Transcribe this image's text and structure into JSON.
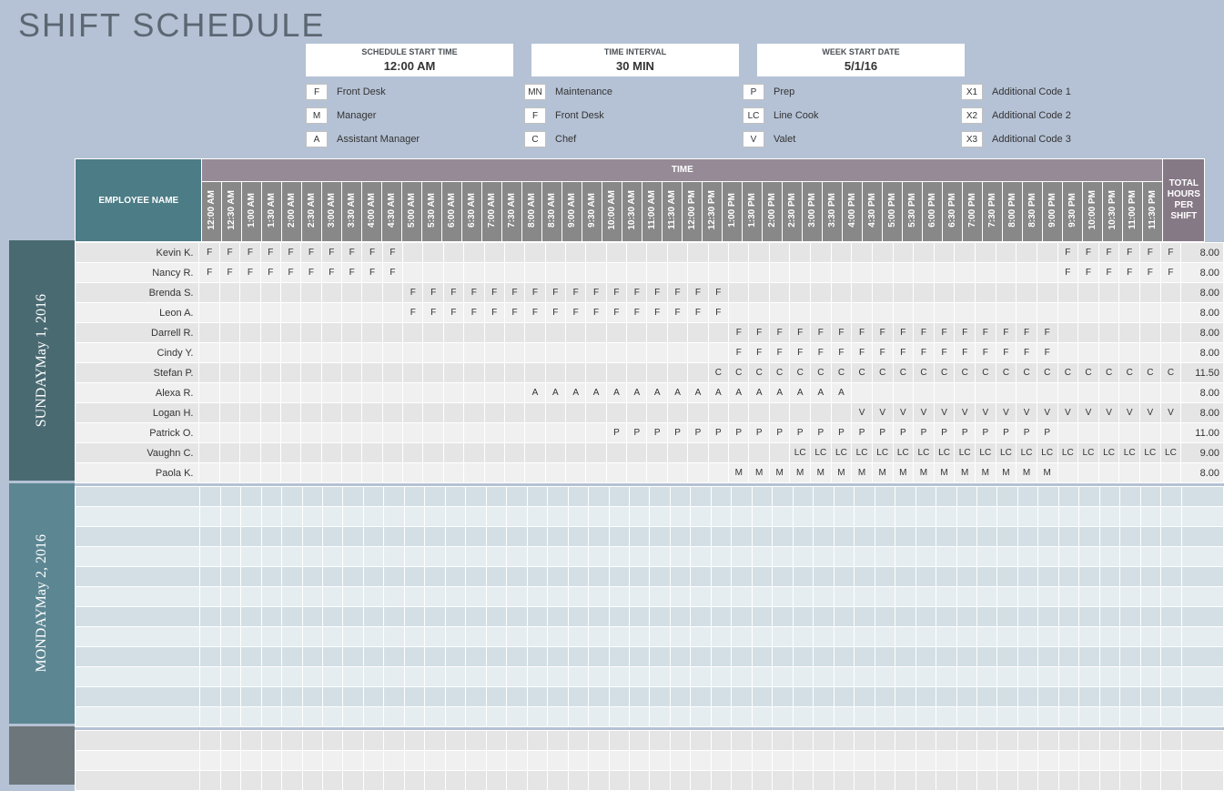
{
  "title": "SHIFT SCHEDULE",
  "hdr": [
    {
      "t": "SCHEDULE START TIME",
      "v": "12:00 AM"
    },
    {
      "t": "TIME INTERVAL",
      "v": "30 MIN"
    },
    {
      "t": "WEEK START DATE",
      "v": "5/1/16"
    }
  ],
  "legend": [
    {
      "c": "F",
      "l": "Front Desk"
    },
    {
      "c": "MN",
      "l": "Maintenance"
    },
    {
      "c": "P",
      "l": "Prep"
    },
    {
      "c": "X1",
      "l": "Additional Code 1"
    },
    {
      "c": "M",
      "l": "Manager"
    },
    {
      "c": "F",
      "l": "Front Desk"
    },
    {
      "c": "LC",
      "l": "Line Cook"
    },
    {
      "c": "X2",
      "l": "Additional Code 2"
    },
    {
      "c": "A",
      "l": "Assistant Manager"
    },
    {
      "c": "C",
      "l": "Chef"
    },
    {
      "c": "V",
      "l": "Valet"
    },
    {
      "c": "X3",
      "l": "Additional Code 3"
    }
  ],
  "cols": {
    "emp": "EMPLOYEE NAME",
    "time": "TIME",
    "total": "TOTAL HOURS PER SHIFT"
  },
  "times": [
    "12:00 AM",
    "12:30 AM",
    "1:00 AM",
    "1:30 AM",
    "2:00 AM",
    "2:30 AM",
    "3:00 AM",
    "3:30 AM",
    "4:00 AM",
    "4:30 AM",
    "5:00 AM",
    "5:30 AM",
    "6:00 AM",
    "6:30 AM",
    "7:00 AM",
    "7:30 AM",
    "8:00 AM",
    "8:30 AM",
    "9:00 AM",
    "9:30 AM",
    "10:00 AM",
    "10:30 AM",
    "11:00 AM",
    "11:30 AM",
    "12:00 PM",
    "12:30 PM",
    "1:00 PM",
    "1:30 PM",
    "2:00 PM",
    "2:30 PM",
    "3:00 PM",
    "3:30 PM",
    "4:00 PM",
    "4:30 PM",
    "5:00 PM",
    "5:30 PM",
    "6:00 PM",
    "6:30 PM",
    "7:00 PM",
    "7:30 PM",
    "8:00 PM",
    "8:30 PM",
    "9:00 PM",
    "9:30 PM",
    "10:00 PM",
    "10:30 PM",
    "11:00 PM",
    "11:30 PM"
  ],
  "days": [
    {
      "name": "SUNDAY",
      "date": "May 1, 2016",
      "rows": [
        {
          "n": "Kevin K.",
          "t": "8.00",
          "s": [
            [
              0,
              9,
              "F"
            ],
            [
              42,
              47,
              "F"
            ]
          ]
        },
        {
          "n": "Nancy R.",
          "t": "8.00",
          "s": [
            [
              0,
              9,
              "F"
            ],
            [
              42,
              47,
              "F"
            ]
          ]
        },
        {
          "n": "Brenda S.",
          "t": "8.00",
          "s": [
            [
              10,
              25,
              "F"
            ]
          ]
        },
        {
          "n": "Leon A.",
          "t": "8.00",
          "s": [
            [
              10,
              25,
              "F"
            ]
          ]
        },
        {
          "n": "Darrell R.",
          "t": "8.00",
          "s": [
            [
              26,
              41,
              "F"
            ]
          ]
        },
        {
          "n": "Cindy Y.",
          "t": "8.00",
          "s": [
            [
              26,
              41,
              "F"
            ]
          ]
        },
        {
          "n": "Stefan P.",
          "t": "11.50",
          "s": [
            [
              25,
              47,
              "C"
            ]
          ]
        },
        {
          "n": "Alexa R.",
          "t": "8.00",
          "s": [
            [
              16,
              31,
              "A"
            ]
          ]
        },
        {
          "n": "Logan H.",
          "t": "8.00",
          "s": [
            [
              32,
              47,
              "V"
            ]
          ]
        },
        {
          "n": "Patrick O.",
          "t": "11.00",
          "s": [
            [
              20,
              41,
              "P"
            ]
          ]
        },
        {
          "n": "Vaughn C.",
          "t": "9.00",
          "s": [
            [
              29,
              47,
              "LC"
            ]
          ]
        },
        {
          "n": "Paola K.",
          "t": "8.00",
          "s": [
            [
              26,
              41,
              "M"
            ]
          ]
        }
      ]
    },
    {
      "name": "MONDAY",
      "date": "May 2, 2016",
      "rows": [
        {
          "n": "",
          "t": "",
          "s": []
        },
        {
          "n": "",
          "t": "",
          "s": []
        },
        {
          "n": "",
          "t": "",
          "s": []
        },
        {
          "n": "",
          "t": "",
          "s": []
        },
        {
          "n": "",
          "t": "",
          "s": []
        },
        {
          "n": "",
          "t": "",
          "s": []
        },
        {
          "n": "",
          "t": "",
          "s": []
        },
        {
          "n": "",
          "t": "",
          "s": []
        },
        {
          "n": "",
          "t": "",
          "s": []
        },
        {
          "n": "",
          "t": "",
          "s": []
        },
        {
          "n": "",
          "t": "",
          "s": []
        },
        {
          "n": "",
          "t": "",
          "s": []
        }
      ]
    }
  ]
}
